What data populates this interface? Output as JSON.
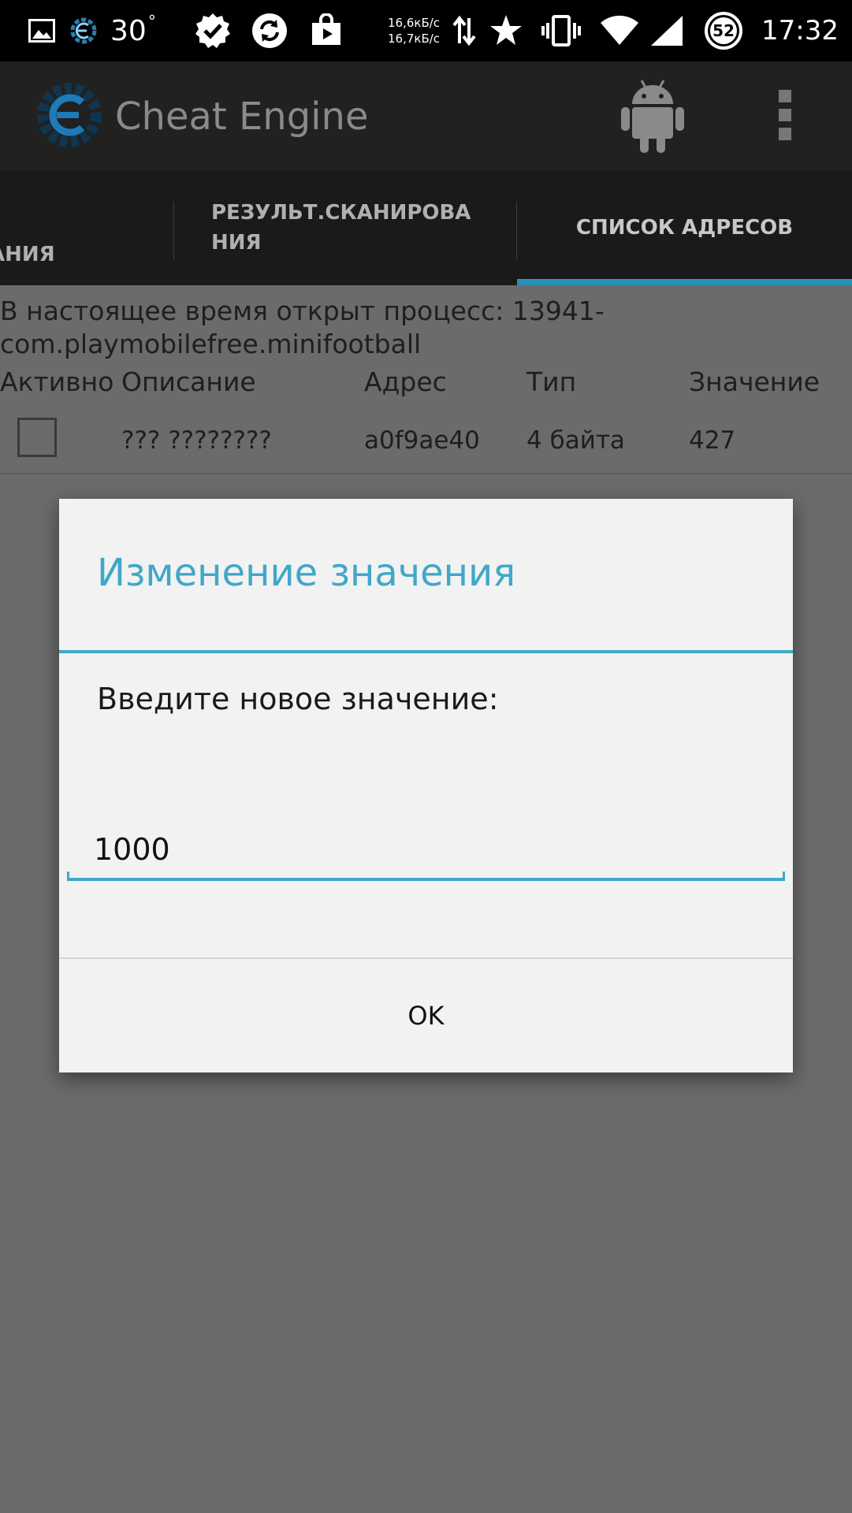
{
  "status_bar": {
    "temperature": "30",
    "temperature_unit": "°",
    "download_speed": "16,6кБ/с",
    "upload_speed": "16,7кБ/с",
    "battery_percent": "52",
    "time": "17:32",
    "icons": [
      "gallery-icon",
      "cheat-engine-notification-icon",
      "check-badge-icon",
      "sync-icon",
      "store-bag-icon",
      "data-arrows-icon",
      "star-icon",
      "vibrate-icon",
      "wifi-icon",
      "signal-icon",
      "battery-icon"
    ]
  },
  "app_bar": {
    "title": "Cheat Engine",
    "icons": [
      "cheat-engine-logo-icon",
      "android-icon",
      "overflow-menu-icon"
    ],
    "accent_color": "#3fa8c8"
  },
  "tabs": [
    {
      "label": "АНИЯ",
      "selected": false
    },
    {
      "label": "РЕЗУЛЬТ.СКАНИРОВАНИЯ",
      "selected": false
    },
    {
      "label": "СПИСОК АДРЕСОВ",
      "selected": true
    }
  ],
  "address_list": {
    "process_info": "В настоящее время открыт процесс: 13941-com.playmobilefree.minifootball",
    "columns": [
      "Активно",
      "Описание",
      "Адрес",
      "Тип",
      "Значение"
    ],
    "rows": [
      {
        "active": false,
        "description": "??? ????????",
        "address": "a0f9ae40",
        "type": "4 байта",
        "value": "427"
      }
    ]
  },
  "dialog": {
    "title": "Изменение значения",
    "message": "Введите новое значение:",
    "input_value": "1000",
    "ok_label": "OK"
  }
}
